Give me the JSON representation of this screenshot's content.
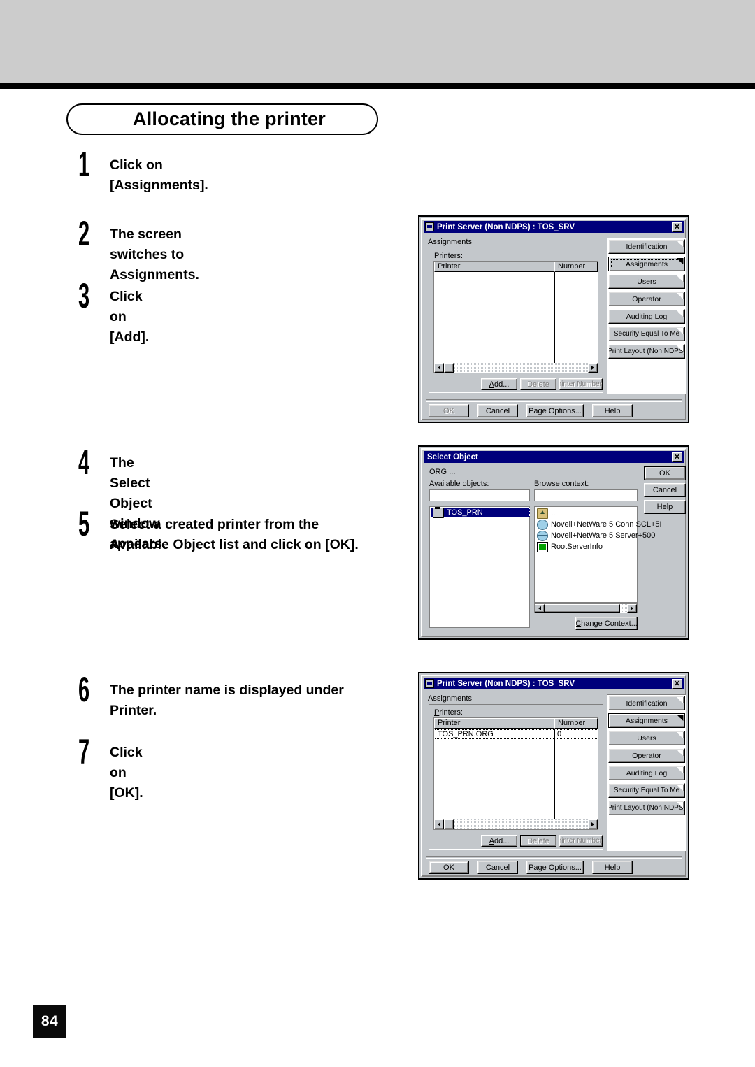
{
  "page": {
    "number": "84",
    "title": "Allocating the printer"
  },
  "steps": [
    {
      "num": "1",
      "text": "Click on [Assignments]."
    },
    {
      "num": "2",
      "text": "The screen switches to Assignments."
    },
    {
      "num": "3",
      "text": "Click on [Add]."
    },
    {
      "num": "4",
      "text": "The Select Object window appears."
    },
    {
      "num": "5",
      "line1": "Select  a  created  printer  from  the",
      "line2": "Available Object list and click on [OK]."
    },
    {
      "num": "6",
      "line1": "The  printer  name  is  displayed  under",
      "line2": "Printer."
    },
    {
      "num": "7",
      "text": "Click on [OK]."
    }
  ],
  "dialog_printserver_empty": {
    "title": "Print Server (Non NDPS) : TOS_SRV",
    "close_label": "✕",
    "group_label": "Assignments",
    "printers_label": "Printers:",
    "printers_label_key": "P",
    "columns": [
      "Printer",
      "Number"
    ],
    "rows": [],
    "list_buttons": [
      {
        "label": "Add...",
        "key": "A",
        "enabled": true
      },
      {
        "label": "Delete",
        "key": "D",
        "enabled": false
      },
      {
        "label": "Printer Number...",
        "key": "P",
        "enabled": false
      }
    ],
    "side_buttons": [
      {
        "label": "Identification",
        "selected": false
      },
      {
        "label": "Assignments",
        "selected": true
      },
      {
        "label": "Users",
        "selected": false
      },
      {
        "label": "Operator",
        "selected": false
      },
      {
        "label": "Auditing Log",
        "selected": false
      },
      {
        "label": "Security Equal To Me",
        "selected": false
      },
      {
        "label": "Print Layout (Non NDPS)",
        "selected": false
      }
    ],
    "footer_buttons": [
      {
        "label": "OK",
        "enabled": false,
        "default": false
      },
      {
        "label": "Cancel",
        "enabled": true,
        "default": false
      },
      {
        "label": "Page Options...",
        "enabled": true,
        "default": false
      },
      {
        "label": "Help",
        "enabled": true,
        "default": false
      }
    ]
  },
  "dialog_select_object": {
    "title": "Select Object",
    "close_label": "✕",
    "context_label": "ORG ...",
    "available_label": "Available objects:",
    "available_label_key": "A",
    "browse_label": "Browse context:",
    "browse_label_key": "B",
    "available_filter_value": "",
    "browse_filter_value": "",
    "available_objects": [
      {
        "label": "TOS_PRN",
        "icon": "printer-icon",
        "selected": true
      }
    ],
    "browse_context": [
      {
        "label": "..",
        "icon": "up-directory-icon"
      },
      {
        "label": "Novell+NetWare 5 Conn SCL+5I",
        "icon": "globe-icon"
      },
      {
        "label": "Novell+NetWare 5 Server+500",
        "icon": "globe-icon"
      },
      {
        "label": "RootServerInfo",
        "icon": "green-square-icon"
      }
    ],
    "right_buttons": [
      {
        "label": "OK",
        "default": true
      },
      {
        "label": "Cancel",
        "default": false
      },
      {
        "label": "Help",
        "key": "H",
        "default": false
      }
    ],
    "change_context_button": {
      "label": "Change Context...",
      "key": "C"
    }
  },
  "dialog_printserver_filled": {
    "title": "Print Server (Non NDPS) : TOS_SRV",
    "close_label": "✕",
    "group_label": "Assignments",
    "printers_label": "Printers:",
    "printers_label_key": "P",
    "columns": [
      "Printer",
      "Number"
    ],
    "rows": [
      {
        "printer": "TOS_PRN.ORG",
        "number": "0"
      }
    ],
    "list_buttons": [
      {
        "label": "Add...",
        "key": "A",
        "enabled": true
      },
      {
        "label": "Delete",
        "key": "D",
        "enabled": false
      },
      {
        "label": "Printer Number...",
        "key": "P",
        "enabled": false
      }
    ],
    "side_buttons": [
      {
        "label": "Identification",
        "selected": false
      },
      {
        "label": "Assignments",
        "selected": true
      },
      {
        "label": "Users",
        "selected": false
      },
      {
        "label": "Operator",
        "selected": false
      },
      {
        "label": "Auditing Log",
        "selected": false
      },
      {
        "label": "Security Equal To Me",
        "selected": false
      },
      {
        "label": "Print Layout (Non NDPS)",
        "selected": false
      }
    ],
    "footer_buttons": [
      {
        "label": "OK",
        "enabled": true,
        "default": true
      },
      {
        "label": "Cancel",
        "enabled": true,
        "default": false
      },
      {
        "label": "Page Options...",
        "enabled": true,
        "default": false
      },
      {
        "label": "Help",
        "enabled": true,
        "default": false
      }
    ]
  },
  "colors": {
    "titlebar": "#00007b",
    "dialog_face": "#c3c7cb",
    "header_band": "#cccccc",
    "selection": "#00007b"
  }
}
